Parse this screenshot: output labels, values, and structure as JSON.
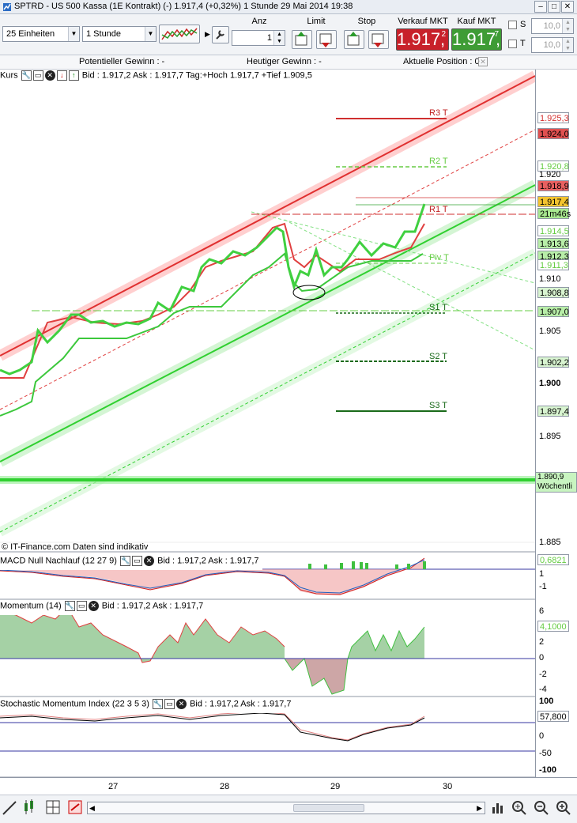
{
  "window": {
    "title": "SPTRD - US 500 Kassa (1E Kontrakt) (-)     1.917,4 (+0,32%)     1 Stunde  29 Mai 2014 19:38",
    "minimize": "–",
    "maximize": "□",
    "close": "✕"
  },
  "toolbar": {
    "units": "25 Einheiten",
    "interval": "1 Stunde",
    "anz_label": "Anz",
    "anz_value": "1",
    "limit_label": "Limit",
    "stop_label": "Stop",
    "sell_label": "Verkauf MKT",
    "buy_label": "Kauf MKT",
    "sell_price": "1.917,",
    "sell_sup": "2",
    "buy_price": "1.917,",
    "buy_sup": "7",
    "s_label": "S",
    "t_label": "T",
    "s_value": "10,0",
    "t_value": "10,0",
    "sell_color": "#c8212a",
    "buy_color": "#3e9c35"
  },
  "gainbar": {
    "potential": "Potentieller Gewinn : -",
    "today": "Heutiger Gewinn : -",
    "position": "Aktuelle Position : 0"
  },
  "main_panel": {
    "name": "Kurs",
    "info": "Bid : 1.917,2 Ask : 1.917,7 Tag:+Hoch 1.917,7 +Tief 1.909,5",
    "copyright": "© IT-Finance.com  Daten sind indikativ",
    "axis": [
      "1.920",
      "1.910",
      "1.905",
      "1.900",
      "1.895",
      "1.885"
    ],
    "tags": [
      {
        "v": "1.925,3",
        "c": "#d43030",
        "bg": "#fff"
      },
      {
        "v": "1.924,0",
        "c": "#000",
        "bg": "#e05050"
      },
      {
        "v": "1.920,8",
        "c": "#66cc44",
        "bg": "#fff"
      },
      {
        "v": "1.918,9",
        "c": "#000",
        "bg": "#e86060"
      },
      {
        "v": "1.917,4",
        "c": "#000",
        "bg": "#f4c430"
      },
      {
        "v": "21m46s",
        "c": "#000",
        "bg": "#a8e890"
      },
      {
        "v": "1.914,5",
        "c": "#66cc44",
        "bg": "#fff"
      },
      {
        "v": "1.913,6",
        "c": "#000",
        "bg": "#b8eea8"
      },
      {
        "v": "1.912,3",
        "c": "#000",
        "bg": "#b8eea8"
      },
      {
        "v": "1.911,3",
        "c": "#66cc44",
        "bg": "#fff"
      },
      {
        "v": "1.908,8",
        "c": "#000",
        "bg": "#d8f4d0"
      },
      {
        "v": "1.907,0",
        "c": "#000",
        "bg": "#b8eea8"
      },
      {
        "v": "1.902,2",
        "c": "#000",
        "bg": "#d8f4d0"
      },
      {
        "v": "1.897,4",
        "c": "#000",
        "bg": "#d8f4d0"
      }
    ],
    "weekly_tag": "1.890,9",
    "weekly_label": "Wöchentli",
    "levels": [
      "R3 T",
      "R2 T",
      "R1 T",
      "Piv T",
      "S1 T",
      "S2 T",
      "S3 T"
    ]
  },
  "macd_panel": {
    "name": "MACD Null Nachlauf (12 27 9)",
    "info": "Bid : 1.917,2 Ask : 1.917,7",
    "value": "0,6821",
    "axis": [
      "1",
      "-1"
    ]
  },
  "momentum_panel": {
    "name": "Momentum (14)",
    "info": "Bid : 1.917,2 Ask : 1.917,7",
    "value": "4,1000",
    "axis": [
      "6",
      "2",
      "0",
      "-2",
      "-4"
    ]
  },
  "stoch_panel": {
    "name": "Stochastic Momentum Index (22 3 5 3)",
    "info": "Bid : 1.917,2 Ask : 1.917,7",
    "value": "57,800",
    "axis": [
      "100",
      "0",
      "-50",
      "-100"
    ]
  },
  "xaxis": [
    "27",
    "28",
    "29",
    "30"
  ]
}
